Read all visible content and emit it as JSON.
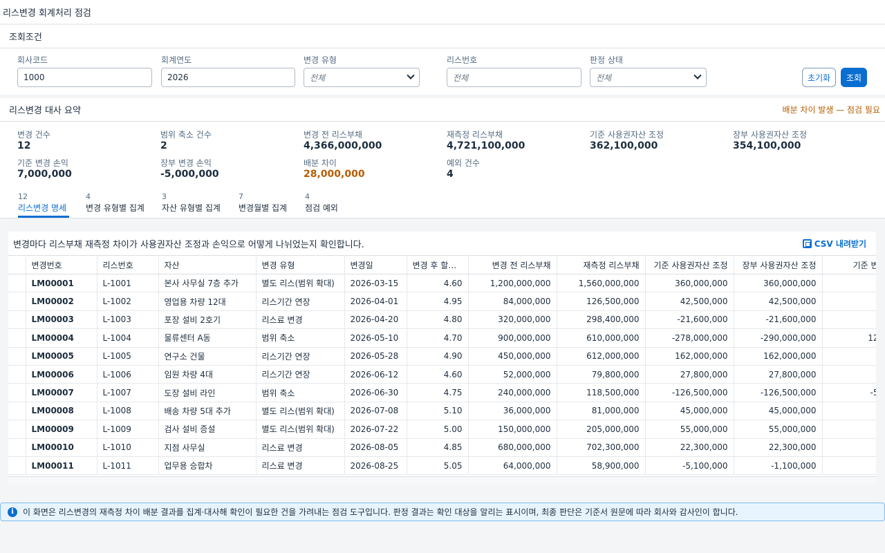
{
  "page_title": "리스변경 회계처리 점검",
  "filters": {
    "section_title": "조회조건",
    "company_code": {
      "label": "회사코드",
      "value": "1000"
    },
    "fiscal_year": {
      "label": "회계연도",
      "value": "2026"
    },
    "change_type": {
      "label": "변경 유형",
      "value": "전체"
    },
    "lease_no": {
      "label": "리스번호",
      "placeholder": "전체"
    },
    "status": {
      "label": "판정 상태",
      "value": "전체"
    },
    "reset_label": "초기화",
    "search_label": "조회"
  },
  "summary": {
    "title": "리스변경 대사 요약",
    "warning": "배분 차이 발생 — 점검 필요",
    "items": [
      {
        "label": "변경 건수",
        "value": "12"
      },
      {
        "label": "범위 축소 건수",
        "value": "2"
      },
      {
        "label": "변경 전 리스부채",
        "value": "4,366,000,000"
      },
      {
        "label": "재측정 리스부채",
        "value": "4,721,100,000"
      },
      {
        "label": "기준 사용권자산 조정",
        "value": "362,100,000"
      },
      {
        "label": "장부 사용권자산 조정",
        "value": "354,100,000"
      },
      {
        "label": "기준 변경 손익",
        "value": "7,000,000"
      },
      {
        "label": "장부 변경 손익",
        "value": "-5,000,000"
      },
      {
        "label": "배분 차이",
        "value": "28,000,000"
      },
      {
        "label": "예외 건수",
        "value": "4"
      }
    ]
  },
  "tabs": [
    {
      "count": "12",
      "label": "리스변경 명세"
    },
    {
      "count": "4",
      "label": "변경 유형별 집계"
    },
    {
      "count": "3",
      "label": "자산 유형별 집계"
    },
    {
      "count": "7",
      "label": "변경월별 집계"
    },
    {
      "count": "4",
      "label": "점검 예외"
    }
  ],
  "table": {
    "description": "변경마다 리스부채 재측정 차이가 사용권자산 조정과 손익으로 어떻게 나뉘었는지 확인합니다.",
    "csv_label": "CSV 내려받기",
    "headers": [
      "변경번호",
      "리스번호",
      "자산",
      "변경 유형",
      "변경일",
      "변경 후 할인...",
      "변경 전 리스부채",
      "재측정 리스부채",
      "기준 사용권자산 조정",
      "장부 사용권자산 조정",
      "기준 변"
    ],
    "rows": [
      [
        "LM00001",
        "L-1001",
        "본사 사무실 7층 추가",
        "별도 리스(범위 확대)",
        "2026-03-15",
        "4.60",
        "1,200,000,000",
        "1,560,000,000",
        "360,000,000",
        "360,000,000",
        ""
      ],
      [
        "LM00002",
        "L-1002",
        "영업용 차량 12대",
        "리스기간 연장",
        "2026-04-01",
        "4.95",
        "84,000,000",
        "126,500,000",
        "42,500,000",
        "42,500,000",
        ""
      ],
      [
        "LM00003",
        "L-1003",
        "포장 설비 2호기",
        "리스료 변경",
        "2026-04-20",
        "4.80",
        "320,000,000",
        "298,400,000",
        "-21,600,000",
        "-21,600,000",
        ""
      ],
      [
        "LM00004",
        "L-1004",
        "물류센터 A동",
        "범위 축소",
        "2026-05-10",
        "4.70",
        "900,000,000",
        "610,000,000",
        "-278,000,000",
        "-290,000,000",
        "12"
      ],
      [
        "LM00005",
        "L-1005",
        "연구소 건물",
        "리스기간 연장",
        "2026-05-28",
        "4.90",
        "450,000,000",
        "612,000,000",
        "162,000,000",
        "162,000,000",
        ""
      ],
      [
        "LM00006",
        "L-1006",
        "임원 차량 4대",
        "리스기간 연장",
        "2026-06-12",
        "4.60",
        "52,000,000",
        "79,800,000",
        "27,800,000",
        "27,800,000",
        ""
      ],
      [
        "LM00007",
        "L-1007",
        "도장 설비 라인",
        "범위 축소",
        "2026-06-30",
        "4.75",
        "240,000,000",
        "118,500,000",
        "-126,500,000",
        "-126,500,000",
        "-5"
      ],
      [
        "LM00008",
        "L-1008",
        "배송 차량 5대 추가",
        "별도 리스(범위 확대)",
        "2026-07-08",
        "5.10",
        "36,000,000",
        "81,000,000",
        "45,000,000",
        "45,000,000",
        ""
      ],
      [
        "LM00009",
        "L-1009",
        "검사 설비 증설",
        "별도 리스(범위 확대)",
        "2026-07-22",
        "5.00",
        "150,000,000",
        "205,000,000",
        "55,000,000",
        "55,000,000",
        ""
      ],
      [
        "LM00010",
        "L-1010",
        "지점 사무실",
        "리스료 변경",
        "2026-08-05",
        "4.85",
        "680,000,000",
        "702,300,000",
        "22,300,000",
        "22,300,000",
        ""
      ],
      [
        "LM00011",
        "L-1011",
        "업무용 승합차",
        "리스료 변경",
        "2026-08-25",
        "5.05",
        "64,000,000",
        "58,900,000",
        "-5,100,000",
        "-1,100,000",
        ""
      ]
    ]
  },
  "info_text": "이 화면은 리스변경의 재측정 차이 배분 결과를 집계·대사해 확인이 필요한 건을 가려내는 점검 도구입니다. 판정 결과는 확인 대상을 알리는 표시이며, 최종 판단은 기준서 원문에 따라 회사와 감사인이 합니다."
}
